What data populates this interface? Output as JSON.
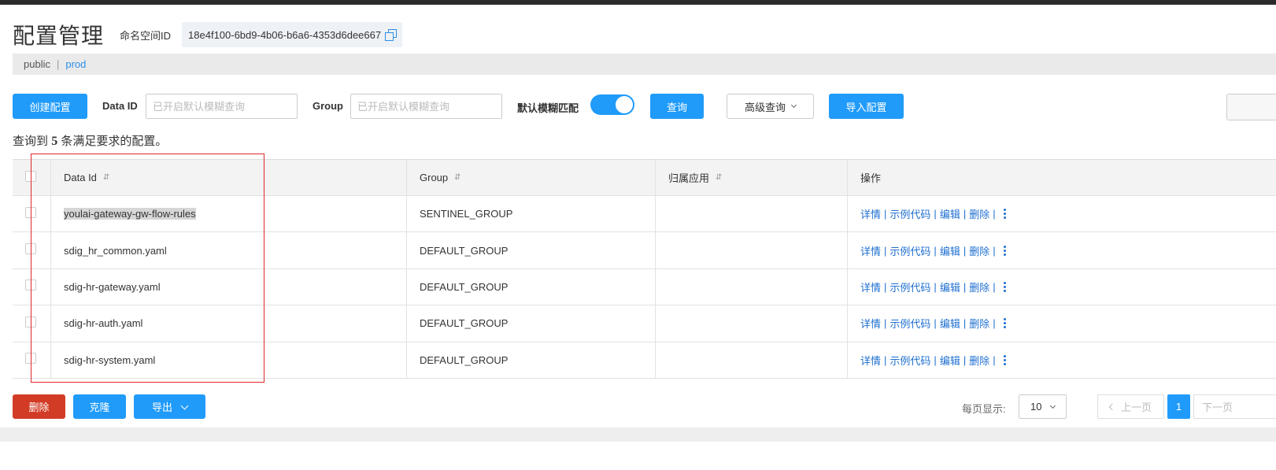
{
  "header": {
    "title": "配置管理",
    "namespace_label": "命名空间ID",
    "namespace_id": "18e4f100-6bd9-4b06-b6a6-4353d6dee667"
  },
  "namespaces": {
    "public": "public",
    "separator": "|",
    "prod": "prod"
  },
  "toolbar": {
    "create_label": "创建配置",
    "dataid_label": "Data ID",
    "dataid_placeholder": "已开启默认模糊查询",
    "group_label": "Group",
    "group_placeholder": "已开启默认模糊查询",
    "fuzzy_label": "默认模糊匹配",
    "fuzzy_enabled": true,
    "query_label": "查询",
    "advanced_label": "高级查询",
    "import_label": "导入配置"
  },
  "result": {
    "prefix": "查询到",
    "count": "5",
    "suffix": "条满足要求的配置。"
  },
  "table": {
    "headers": {
      "data_id": "Data Id",
      "group": "Group",
      "app": "归属应用",
      "ops": "操作"
    },
    "sort_icon": "⇵",
    "rows": [
      {
        "data_id": "youlai-gateway-gw-flow-rules",
        "group": "SENTINEL_GROUP",
        "app": ""
      },
      {
        "data_id": "sdig_hr_common.yaml",
        "group": "DEFAULT_GROUP",
        "app": ""
      },
      {
        "data_id": "sdig-hr-gateway.yaml",
        "group": "DEFAULT_GROUP",
        "app": ""
      },
      {
        "data_id": "sdig-hr-auth.yaml",
        "group": "DEFAULT_GROUP",
        "app": ""
      },
      {
        "data_id": "sdig-hr-system.yaml",
        "group": "DEFAULT_GROUP",
        "app": ""
      }
    ],
    "ops": {
      "detail": "详情",
      "sample": "示例代码",
      "edit": "编辑",
      "delete": "删除",
      "sep": "|"
    }
  },
  "bottom": {
    "delete_label": "删除",
    "clone_label": "克隆",
    "export_label": "导出",
    "per_page_label": "每页显示:",
    "per_page_value": "10",
    "prev_label": "上一页",
    "current_page": "1",
    "next_label": "下一页"
  },
  "colors": {
    "primary": "#209bfa",
    "danger": "#d23c26",
    "link": "#1e6fd0",
    "highlight_box": "#e0262c"
  }
}
